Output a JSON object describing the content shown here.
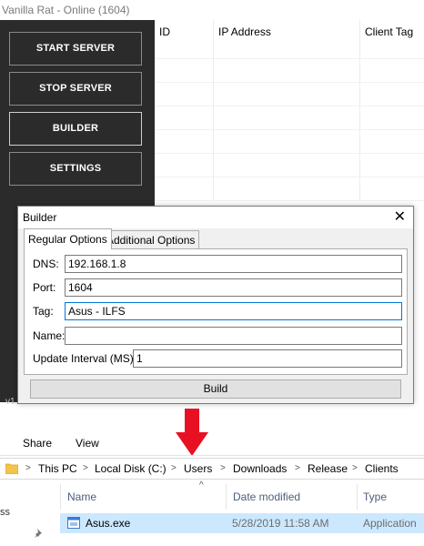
{
  "window": {
    "title": "Vanilla Rat - Online (1604)"
  },
  "sidebar": {
    "buttons": [
      {
        "label": "START SERVER"
      },
      {
        "label": "STOP SERVER"
      },
      {
        "label": "BUILDER"
      },
      {
        "label": "SETTINGS"
      }
    ],
    "version_partial": "v1."
  },
  "clients_table": {
    "columns": [
      "ID",
      "IP Address",
      "Client Tag"
    ]
  },
  "builder": {
    "title": "Builder",
    "tabs": [
      "Regular Options",
      "Additional Options"
    ],
    "fields": {
      "dns": {
        "label": "DNS:",
        "value": "192.168.1.8"
      },
      "port": {
        "label": "Port:",
        "value": "1604"
      },
      "tag": {
        "label": "Tag:",
        "value": "Asus - ILFS"
      },
      "name": {
        "label": "Name:",
        "value": ""
      },
      "interval": {
        "label": "Update Interval (MS):",
        "value": "1"
      }
    },
    "build_label": "Build"
  },
  "annotation": {
    "arrow_color": "#e81123"
  },
  "explorer": {
    "ribbon": [
      "Share",
      "View"
    ],
    "breadcrumb": [
      "This PC",
      "Local Disk (C:)",
      "Users",
      "Downloads",
      "Release",
      "Clients"
    ],
    "nav_partial": "ss",
    "columns": {
      "name": "Name",
      "date": "Date modified",
      "type": "Type"
    },
    "files": [
      {
        "name": "Asus.exe",
        "date": "5/28/2019 11:58 AM",
        "type": "Application"
      }
    ]
  }
}
